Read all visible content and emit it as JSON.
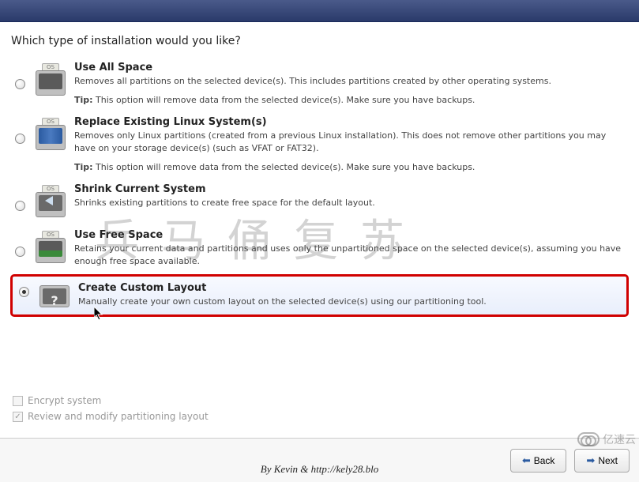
{
  "question": "Which type of installation would you like?",
  "options": [
    {
      "id": "use-all",
      "title": "Use All Space",
      "desc": "Removes all partitions on the selected device(s).  This includes partitions created by other operating systems.",
      "tip_label": "Tip:",
      "tip": "This option will remove data from the selected device(s).  Make sure you have backups."
    },
    {
      "id": "replace-linux",
      "title": "Replace Existing Linux System(s)",
      "desc": "Removes only Linux partitions (created from a previous Linux installation).  This does not remove other partitions you may have on your storage device(s) (such as VFAT or FAT32).",
      "tip_label": "Tip:",
      "tip": "This option will remove data from the selected device(s).  Make sure you have backups."
    },
    {
      "id": "shrink",
      "title": "Shrink Current System",
      "desc": "Shrinks existing partitions to create free space for the default layout."
    },
    {
      "id": "free-space",
      "title": "Use Free Space",
      "desc": "Retains your current data and partitions and uses only the unpartitioned space on the selected device(s), assuming you have enough free space available."
    },
    {
      "id": "custom",
      "title": "Create Custom Layout",
      "desc": "Manually create your own custom layout on the selected device(s) using our partitioning tool."
    }
  ],
  "checkboxes": {
    "encrypt": {
      "label": "Encrypt system",
      "checked": false
    },
    "review": {
      "label": "Review and modify partitioning layout",
      "checked": true
    }
  },
  "buttons": {
    "back": "Back",
    "next": "Next"
  },
  "icon_tab_label": "OS",
  "watermark_cn": "兵马俑复苏",
  "attribution": "By Kevin & http://kely28.blo",
  "logo_text": "亿速云"
}
